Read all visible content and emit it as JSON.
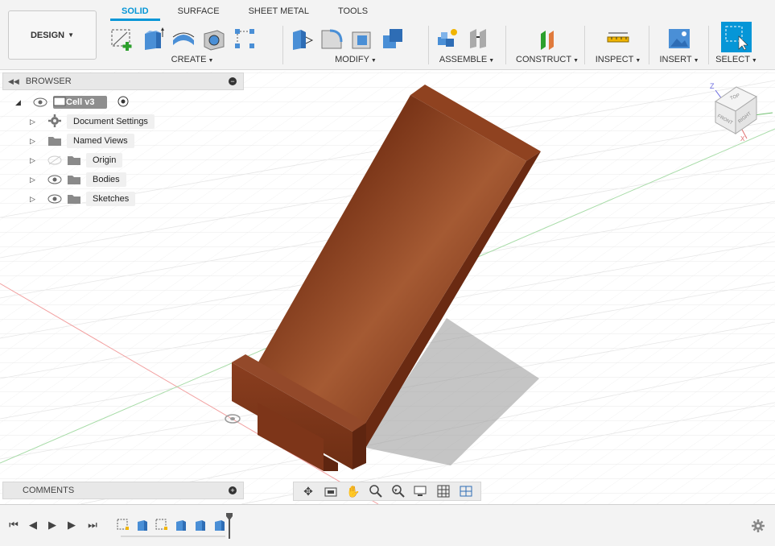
{
  "app": {
    "workspace_label": "DESIGN",
    "tabs": [
      {
        "label": "SOLID",
        "active": true
      },
      {
        "label": "SURFACE",
        "active": false
      },
      {
        "label": "SHEET METAL",
        "active": false
      },
      {
        "label": "TOOLS",
        "active": false
      }
    ],
    "groups": {
      "create": "CREATE",
      "modify": "MODIFY",
      "assemble": "ASSEMBLE",
      "construct": "CONSTRUCT",
      "inspect": "INSPECT",
      "insert": "INSERT",
      "select": "SELECT"
    },
    "accent_color": "#0696d7"
  },
  "browser": {
    "title": "BROWSER",
    "root": "Cell v3",
    "items": [
      {
        "label": "Document Settings",
        "icon": "gear-icon"
      },
      {
        "label": "Named Views",
        "icon": "folder-icon"
      },
      {
        "label": "Origin",
        "icon": "folder-icon",
        "hidden": true
      },
      {
        "label": "Bodies",
        "icon": "folder-icon"
      },
      {
        "label": "Sketches",
        "icon": "folder-icon"
      }
    ]
  },
  "comments": {
    "title": "COMMENTS"
  },
  "viewcube": {
    "top": "TOP",
    "front": "FRONT",
    "right": "RIGHT",
    "axis_z": "Z",
    "axis_x": "X"
  },
  "model": {
    "material_color": "#8b3a1c"
  }
}
